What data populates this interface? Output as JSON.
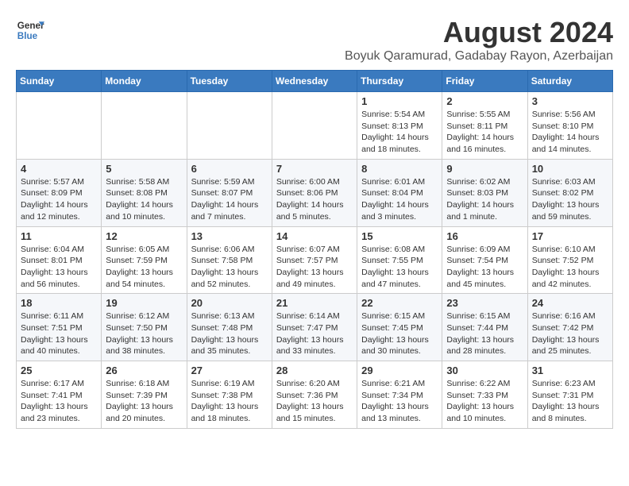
{
  "header": {
    "logo_line1": "General",
    "logo_line2": "Blue",
    "main_title": "August 2024",
    "subtitle": "Boyuk Qaramurad, Gadabay Rayon, Azerbaijan"
  },
  "weekdays": [
    "Sunday",
    "Monday",
    "Tuesday",
    "Wednesday",
    "Thursday",
    "Friday",
    "Saturday"
  ],
  "weeks": [
    [
      {
        "day": "",
        "info": ""
      },
      {
        "day": "",
        "info": ""
      },
      {
        "day": "",
        "info": ""
      },
      {
        "day": "",
        "info": ""
      },
      {
        "day": "1",
        "info": "Sunrise: 5:54 AM\nSunset: 8:13 PM\nDaylight: 14 hours\nand 18 minutes."
      },
      {
        "day": "2",
        "info": "Sunrise: 5:55 AM\nSunset: 8:11 PM\nDaylight: 14 hours\nand 16 minutes."
      },
      {
        "day": "3",
        "info": "Sunrise: 5:56 AM\nSunset: 8:10 PM\nDaylight: 14 hours\nand 14 minutes."
      }
    ],
    [
      {
        "day": "4",
        "info": "Sunrise: 5:57 AM\nSunset: 8:09 PM\nDaylight: 14 hours\nand 12 minutes."
      },
      {
        "day": "5",
        "info": "Sunrise: 5:58 AM\nSunset: 8:08 PM\nDaylight: 14 hours\nand 10 minutes."
      },
      {
        "day": "6",
        "info": "Sunrise: 5:59 AM\nSunset: 8:07 PM\nDaylight: 14 hours\nand 7 minutes."
      },
      {
        "day": "7",
        "info": "Sunrise: 6:00 AM\nSunset: 8:06 PM\nDaylight: 14 hours\nand 5 minutes."
      },
      {
        "day": "8",
        "info": "Sunrise: 6:01 AM\nSunset: 8:04 PM\nDaylight: 14 hours\nand 3 minutes."
      },
      {
        "day": "9",
        "info": "Sunrise: 6:02 AM\nSunset: 8:03 PM\nDaylight: 14 hours\nand 1 minute."
      },
      {
        "day": "10",
        "info": "Sunrise: 6:03 AM\nSunset: 8:02 PM\nDaylight: 13 hours\nand 59 minutes."
      }
    ],
    [
      {
        "day": "11",
        "info": "Sunrise: 6:04 AM\nSunset: 8:01 PM\nDaylight: 13 hours\nand 56 minutes."
      },
      {
        "day": "12",
        "info": "Sunrise: 6:05 AM\nSunset: 7:59 PM\nDaylight: 13 hours\nand 54 minutes."
      },
      {
        "day": "13",
        "info": "Sunrise: 6:06 AM\nSunset: 7:58 PM\nDaylight: 13 hours\nand 52 minutes."
      },
      {
        "day": "14",
        "info": "Sunrise: 6:07 AM\nSunset: 7:57 PM\nDaylight: 13 hours\nand 49 minutes."
      },
      {
        "day": "15",
        "info": "Sunrise: 6:08 AM\nSunset: 7:55 PM\nDaylight: 13 hours\nand 47 minutes."
      },
      {
        "day": "16",
        "info": "Sunrise: 6:09 AM\nSunset: 7:54 PM\nDaylight: 13 hours\nand 45 minutes."
      },
      {
        "day": "17",
        "info": "Sunrise: 6:10 AM\nSunset: 7:52 PM\nDaylight: 13 hours\nand 42 minutes."
      }
    ],
    [
      {
        "day": "18",
        "info": "Sunrise: 6:11 AM\nSunset: 7:51 PM\nDaylight: 13 hours\nand 40 minutes."
      },
      {
        "day": "19",
        "info": "Sunrise: 6:12 AM\nSunset: 7:50 PM\nDaylight: 13 hours\nand 38 minutes."
      },
      {
        "day": "20",
        "info": "Sunrise: 6:13 AM\nSunset: 7:48 PM\nDaylight: 13 hours\nand 35 minutes."
      },
      {
        "day": "21",
        "info": "Sunrise: 6:14 AM\nSunset: 7:47 PM\nDaylight: 13 hours\nand 33 minutes."
      },
      {
        "day": "22",
        "info": "Sunrise: 6:15 AM\nSunset: 7:45 PM\nDaylight: 13 hours\nand 30 minutes."
      },
      {
        "day": "23",
        "info": "Sunrise: 6:15 AM\nSunset: 7:44 PM\nDaylight: 13 hours\nand 28 minutes."
      },
      {
        "day": "24",
        "info": "Sunrise: 6:16 AM\nSunset: 7:42 PM\nDaylight: 13 hours\nand 25 minutes."
      }
    ],
    [
      {
        "day": "25",
        "info": "Sunrise: 6:17 AM\nSunset: 7:41 PM\nDaylight: 13 hours\nand 23 minutes."
      },
      {
        "day": "26",
        "info": "Sunrise: 6:18 AM\nSunset: 7:39 PM\nDaylight: 13 hours\nand 20 minutes."
      },
      {
        "day": "27",
        "info": "Sunrise: 6:19 AM\nSunset: 7:38 PM\nDaylight: 13 hours\nand 18 minutes."
      },
      {
        "day": "28",
        "info": "Sunrise: 6:20 AM\nSunset: 7:36 PM\nDaylight: 13 hours\nand 15 minutes."
      },
      {
        "day": "29",
        "info": "Sunrise: 6:21 AM\nSunset: 7:34 PM\nDaylight: 13 hours\nand 13 minutes."
      },
      {
        "day": "30",
        "info": "Sunrise: 6:22 AM\nSunset: 7:33 PM\nDaylight: 13 hours\nand 10 minutes."
      },
      {
        "day": "31",
        "info": "Sunrise: 6:23 AM\nSunset: 7:31 PM\nDaylight: 13 hours\nand 8 minutes."
      }
    ]
  ]
}
